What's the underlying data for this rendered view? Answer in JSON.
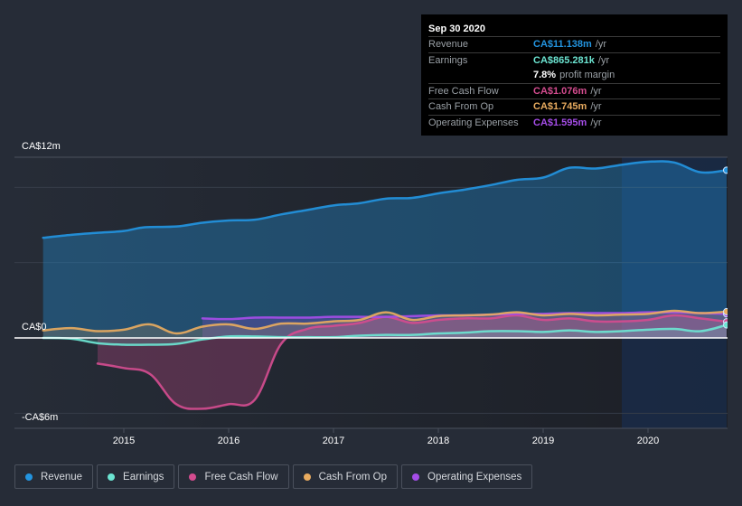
{
  "tooltip": {
    "date": "Sep 30 2020",
    "rows": [
      {
        "label": "Revenue",
        "value": "CA$11.138m",
        "unit": "/yr",
        "color": "#2394df"
      },
      {
        "label": "Earnings",
        "value": "CA$865.281k",
        "unit": "/yr",
        "color": "#6ce5d2"
      },
      {
        "label": "",
        "value": "7.8%",
        "unit": "profit margin",
        "color": "#ffffff"
      },
      {
        "label": "Free Cash Flow",
        "value": "CA$1.076m",
        "unit": "/yr",
        "color": "#d44c8f"
      },
      {
        "label": "Cash From Op",
        "value": "CA$1.745m",
        "unit": "/yr",
        "color": "#e8ab5f"
      },
      {
        "label": "Operating Expenses",
        "value": "CA$1.595m",
        "unit": "/yr",
        "color": "#a54de8"
      }
    ]
  },
  "legend": [
    {
      "label": "Revenue",
      "color": "#2394df"
    },
    {
      "label": "Earnings",
      "color": "#6ce5d2"
    },
    {
      "label": "Free Cash Flow",
      "color": "#d44c8f"
    },
    {
      "label": "Cash From Op",
      "color": "#e8ab5f"
    },
    {
      "label": "Operating Expenses",
      "color": "#a54de8"
    }
  ],
  "chart_data": {
    "type": "area",
    "title": "",
    "xlabel": "",
    "ylabel": "",
    "currency": "CA$",
    "ylim": [
      -6,
      12
    ],
    "xlim": [
      2014.23,
      2020.75
    ],
    "y_tick_labels": [
      {
        "value": 12,
        "label": "CA$12m"
      },
      {
        "value": 0,
        "label": "CA$0"
      },
      {
        "value": -6,
        "label": "-CA$6m"
      }
    ],
    "gridlines": [
      12,
      10,
      5,
      0,
      -5,
      -6
    ],
    "x_ticks": [
      {
        "value": 2015,
        "label": "2015"
      },
      {
        "value": 2016,
        "label": "2016"
      },
      {
        "value": 2017,
        "label": "2017"
      },
      {
        "value": 2018,
        "label": "2018"
      },
      {
        "value": 2019,
        "label": "2019"
      },
      {
        "value": 2020,
        "label": "2020"
      }
    ],
    "highlight_range": [
      2019.75,
      2020.75
    ],
    "series": [
      {
        "name": "Revenue",
        "color": "#2394df",
        "fill": true,
        "x": [
          2014.23,
          2014.5,
          2014.75,
          2015.0,
          2015.2,
          2015.5,
          2015.75,
          2016.0,
          2016.25,
          2016.5,
          2016.75,
          2017.0,
          2017.25,
          2017.5,
          2017.75,
          2018.0,
          2018.25,
          2018.5,
          2018.75,
          2019.0,
          2019.25,
          2019.5,
          2019.75,
          2020.0,
          2020.25,
          2020.5,
          2020.75
        ],
        "y": [
          6.65,
          6.85,
          6.98,
          7.1,
          7.35,
          7.4,
          7.65,
          7.8,
          7.85,
          8.2,
          8.5,
          8.8,
          8.95,
          9.25,
          9.3,
          9.6,
          9.85,
          10.15,
          10.5,
          10.65,
          11.3,
          11.25,
          11.5,
          11.7,
          11.65,
          11.0,
          11.138
        ]
      },
      {
        "name": "Earnings",
        "color": "#6ce5d2",
        "fill": true,
        "x": [
          2014.23,
          2014.5,
          2014.75,
          2015.0,
          2015.25,
          2015.5,
          2015.75,
          2016.0,
          2016.25,
          2016.5,
          2016.75,
          2017.0,
          2017.25,
          2017.5,
          2017.75,
          2018.0,
          2018.25,
          2018.5,
          2018.75,
          2019.0,
          2019.25,
          2019.5,
          2019.75,
          2020.0,
          2020.25,
          2020.5,
          2020.75
        ],
        "y": [
          0.0,
          -0.05,
          -0.35,
          -0.45,
          -0.45,
          -0.4,
          -0.1,
          0.1,
          0.1,
          0.05,
          0.05,
          0.05,
          0.15,
          0.2,
          0.2,
          0.3,
          0.35,
          0.45,
          0.45,
          0.4,
          0.5,
          0.4,
          0.45,
          0.55,
          0.6,
          0.45,
          0.865
        ]
      },
      {
        "name": "Free Cash Flow",
        "color": "#d44c8f",
        "fill": true,
        "x": [
          2014.75,
          2015.0,
          2015.25,
          2015.5,
          2015.75,
          2016.0,
          2016.25,
          2016.5,
          2016.75,
          2017.0,
          2017.25,
          2017.5,
          2017.75,
          2018.0,
          2018.25,
          2018.5,
          2018.75,
          2019.0,
          2019.25,
          2019.5,
          2019.75,
          2020.0,
          2020.25,
          2020.5,
          2020.75
        ],
        "y": [
          -1.7,
          -2.0,
          -2.4,
          -4.4,
          -4.7,
          -4.4,
          -4.1,
          -0.4,
          0.6,
          0.8,
          1.0,
          1.4,
          1.0,
          1.2,
          1.3,
          1.3,
          1.5,
          1.2,
          1.3,
          1.1,
          1.1,
          1.2,
          1.5,
          1.3,
          1.076
        ]
      },
      {
        "name": "Cash From Op",
        "color": "#e8ab5f",
        "fill": true,
        "x": [
          2014.23,
          2014.5,
          2014.75,
          2015.0,
          2015.25,
          2015.5,
          2015.75,
          2016.0,
          2016.25,
          2016.5,
          2016.75,
          2017.0,
          2017.25,
          2017.5,
          2017.75,
          2018.0,
          2018.25,
          2018.5,
          2018.75,
          2019.0,
          2019.25,
          2019.5,
          2019.75,
          2020.0,
          2020.25,
          2020.5,
          2020.75
        ],
        "y": [
          0.5,
          0.65,
          0.45,
          0.55,
          0.9,
          0.3,
          0.75,
          0.9,
          0.6,
          0.95,
          0.95,
          1.1,
          1.2,
          1.7,
          1.2,
          1.45,
          1.5,
          1.55,
          1.7,
          1.5,
          1.6,
          1.5,
          1.55,
          1.6,
          1.8,
          1.65,
          1.745
        ]
      },
      {
        "name": "Operating Expenses",
        "color": "#a54de8",
        "fill": true,
        "x": [
          2015.75,
          2016.0,
          2016.25,
          2016.5,
          2016.75,
          2017.0,
          2017.25,
          2017.5,
          2017.75,
          2018.0,
          2018.25,
          2018.5,
          2018.75,
          2019.0,
          2019.25,
          2019.5,
          2019.75,
          2020.0,
          2020.25,
          2020.5,
          2020.75
        ],
        "y": [
          1.3,
          1.25,
          1.35,
          1.35,
          1.35,
          1.4,
          1.4,
          1.4,
          1.45,
          1.5,
          1.5,
          1.55,
          1.6,
          1.6,
          1.65,
          1.65,
          1.65,
          1.7,
          1.7,
          1.65,
          1.595
        ]
      }
    ]
  }
}
